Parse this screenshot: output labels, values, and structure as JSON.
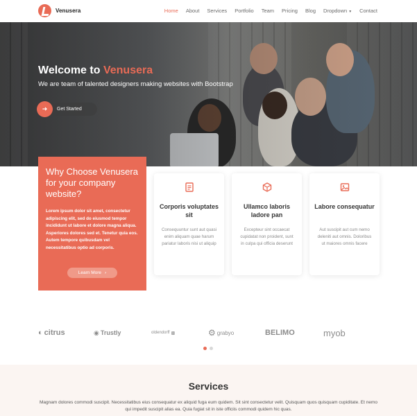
{
  "brand": {
    "name": "Venusera",
    "accent": "#e96b56"
  },
  "nav": {
    "items": [
      "Home",
      "About",
      "Services",
      "Portfolio",
      "Team",
      "Pricing",
      "Blog",
      "Dropdown",
      "Contact"
    ],
    "active": "Home"
  },
  "hero": {
    "title_prefix": "Welcome to ",
    "title_accent": "Venusera",
    "subtitle": "We are team of talented designers making websites with Bootstrap",
    "cta": "Get Started"
  },
  "why": {
    "title": "Why Choose Venusera for your company website?",
    "text": "Lorem ipsum dolor sit amet, consectetur adipiscing elit, sed do eiusmod tempor incididunt ut labore et dolore magna aliqua. Asperiores dolores sed et. Tenetur quia eos. Autem tempore quibusdam vel necessitatibus optio ad corporis.",
    "button": "Learn More"
  },
  "cards": [
    {
      "icon": "receipt-icon",
      "title": "Corporis voluptates sit",
      "text": "Consequuntur sunt aut quasi enim aliquam quae harum pariatur laboris nisi ut aliquip"
    },
    {
      "icon": "cube-icon",
      "title": "Ullamco laboris ladore pan",
      "text": "Excepteur sint occaecat cupidatat non proident, sunt in culpa qui officia deserunt"
    },
    {
      "icon": "image-icon",
      "title": "Labore consequatur",
      "text": "Aut suscipit aut cum nemo deleniti aut omnis. Doloribus ut maiores omnis facere"
    }
  ],
  "clients": [
    "citrus",
    "Trustly",
    "oldendorff",
    "grabyo",
    "BELIMO",
    "myob"
  ],
  "carousel": {
    "total": 2,
    "active": 1
  },
  "services": {
    "title": "Services",
    "description": "Magnam dolores commodi suscipit. Necessitatibus eius consequatur ex aliquid fuga eum quidem. Sit sint consectetur velit. Quisquam quos quisquam cupiditate. Et nemo qui impedit suscipit alias ea. Quia fugiat sit in iste officiis commodi quidem hic quas."
  }
}
